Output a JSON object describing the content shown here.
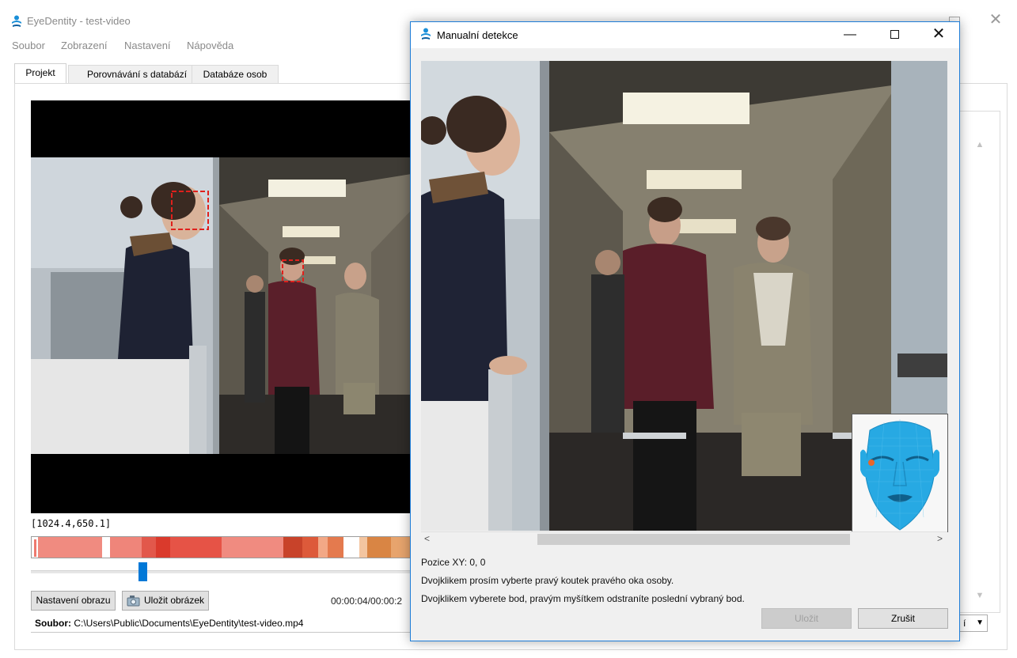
{
  "main": {
    "title": "EyeDentity - test-video",
    "menu": [
      "Soubor",
      "Zobrazení",
      "Nastavení",
      "Nápověda"
    ],
    "tabs": [
      "Projekt",
      "Porovnávání s databází",
      "Databáze osob"
    ],
    "coord_readout": "[1024.4,650.1]",
    "buttons": {
      "image_settings": "Nastavení obrazu",
      "save_image": "Uložit obrázek"
    },
    "time": "00:00:04/00:00:2",
    "file_label": "Soubor:",
    "file_path": "C:\\Users\\Public\\Documents\\EyeDentity\\test-video.mp4",
    "combo_value": "í",
    "slider_position": 0.29
  },
  "dialog": {
    "title": "Manualní detekce",
    "position": "Pozice XY: 0, 0",
    "instruction_1": "Dvojklikem prosím vyberte pravý koutek pravého oka osoby.",
    "instruction_2": "Dvojklikem vyberete bod, pravým myšítkem odstraníte poslední vybraný bod.",
    "save_label": "Uložit",
    "cancel_label": "Zrušit"
  },
  "colors": {
    "accent": "#0078d7",
    "detection_box": "#e0201c",
    "face_model": "#27a9e3",
    "selected_point": "#e8662a"
  },
  "icons": [
    "app-logo-icon",
    "save-image-icon",
    "close-icon",
    "minimize-icon",
    "maximize-icon",
    "scroll-left-icon",
    "scroll-right-icon",
    "chevron-up-icon",
    "chevron-down-icon"
  ]
}
